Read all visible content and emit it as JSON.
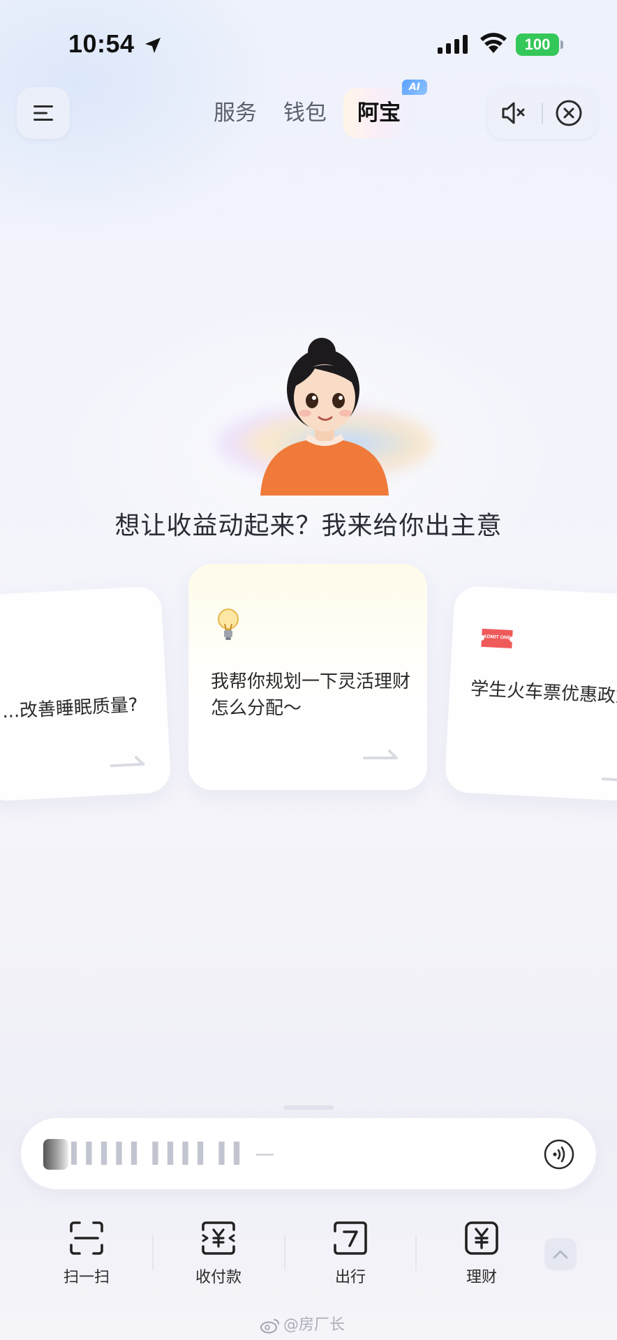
{
  "status_bar": {
    "time": "10:54",
    "battery": "100",
    "icons": [
      "location-arrow-icon",
      "cellular-signal-icon",
      "wifi-icon",
      "battery-icon"
    ]
  },
  "header": {
    "tabs": [
      {
        "label": "服务",
        "active": false
      },
      {
        "label": "钱包",
        "active": false
      },
      {
        "label": "阿宝",
        "active": true,
        "badge": "AI"
      }
    ],
    "icons": [
      "menu-icon",
      "speaker-mute-icon",
      "close-circle-icon"
    ]
  },
  "assistant": {
    "avatar": "cartoon-girl-avatar",
    "headline": "想让收益动起来？我来给你出主意"
  },
  "cards": [
    {
      "text": "...改善睡眠质量?",
      "icon": "",
      "position": "left"
    },
    {
      "text": "我帮你规划一下灵活理财怎么分配～",
      "icon": "lightbulb-icon",
      "position": "center"
    },
    {
      "text": "学生火车票优惠政策有哪些?",
      "icon": "ticket-icon",
      "ticket_text": "ADMIT ONE",
      "position": "right"
    }
  ],
  "input": {
    "placeholder": "▍▍▍▍▍ ▍▍▍▍ ▍▍ —",
    "voice_icon": "voice-wave-icon"
  },
  "shortcuts": [
    {
      "label": "扫一扫",
      "icon": "scan-icon"
    },
    {
      "label": "收付款",
      "icon": "receive-pay-icon"
    },
    {
      "label": "出行",
      "icon": "travel-icon"
    },
    {
      "label": "理财",
      "icon": "finance-yuan-icon"
    }
  ],
  "collapse_icon": "chevron-up-icon",
  "watermark": {
    "text": "@房厂长",
    "icon": "weibo-icon"
  },
  "colors": {
    "battery_green": "#34c759",
    "ai_badge_blue": "#5aa2ff",
    "avatar_shirt": "#f07a3a"
  }
}
